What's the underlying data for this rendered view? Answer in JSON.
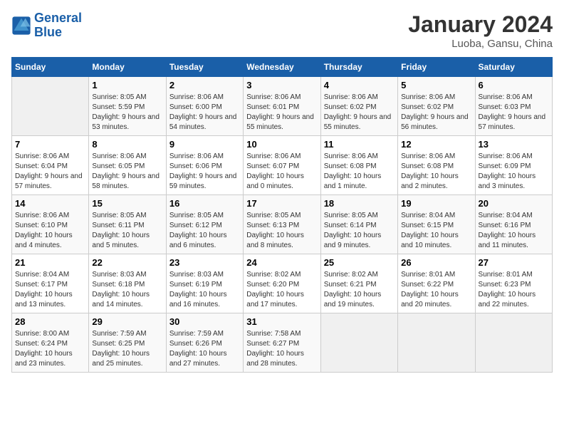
{
  "header": {
    "logo_general": "General",
    "logo_blue": "Blue",
    "title": "January 2024",
    "subtitle": "Luoba, Gansu, China"
  },
  "columns": [
    "Sunday",
    "Monday",
    "Tuesday",
    "Wednesday",
    "Thursday",
    "Friday",
    "Saturday"
  ],
  "weeks": [
    [
      {
        "day": "",
        "sunrise": "",
        "sunset": "",
        "daylight": ""
      },
      {
        "day": "1",
        "sunrise": "Sunrise: 8:05 AM",
        "sunset": "Sunset: 5:59 PM",
        "daylight": "Daylight: 9 hours and 53 minutes."
      },
      {
        "day": "2",
        "sunrise": "Sunrise: 8:06 AM",
        "sunset": "Sunset: 6:00 PM",
        "daylight": "Daylight: 9 hours and 54 minutes."
      },
      {
        "day": "3",
        "sunrise": "Sunrise: 8:06 AM",
        "sunset": "Sunset: 6:01 PM",
        "daylight": "Daylight: 9 hours and 55 minutes."
      },
      {
        "day": "4",
        "sunrise": "Sunrise: 8:06 AM",
        "sunset": "Sunset: 6:02 PM",
        "daylight": "Daylight: 9 hours and 55 minutes."
      },
      {
        "day": "5",
        "sunrise": "Sunrise: 8:06 AM",
        "sunset": "Sunset: 6:02 PM",
        "daylight": "Daylight: 9 hours and 56 minutes."
      },
      {
        "day": "6",
        "sunrise": "Sunrise: 8:06 AM",
        "sunset": "Sunset: 6:03 PM",
        "daylight": "Daylight: 9 hours and 57 minutes."
      }
    ],
    [
      {
        "day": "7",
        "sunrise": "Sunrise: 8:06 AM",
        "sunset": "Sunset: 6:04 PM",
        "daylight": "Daylight: 9 hours and 57 minutes."
      },
      {
        "day": "8",
        "sunrise": "Sunrise: 8:06 AM",
        "sunset": "Sunset: 6:05 PM",
        "daylight": "Daylight: 9 hours and 58 minutes."
      },
      {
        "day": "9",
        "sunrise": "Sunrise: 8:06 AM",
        "sunset": "Sunset: 6:06 PM",
        "daylight": "Daylight: 9 hours and 59 minutes."
      },
      {
        "day": "10",
        "sunrise": "Sunrise: 8:06 AM",
        "sunset": "Sunset: 6:07 PM",
        "daylight": "Daylight: 10 hours and 0 minutes."
      },
      {
        "day": "11",
        "sunrise": "Sunrise: 8:06 AM",
        "sunset": "Sunset: 6:08 PM",
        "daylight": "Daylight: 10 hours and 1 minute."
      },
      {
        "day": "12",
        "sunrise": "Sunrise: 8:06 AM",
        "sunset": "Sunset: 6:08 PM",
        "daylight": "Daylight: 10 hours and 2 minutes."
      },
      {
        "day": "13",
        "sunrise": "Sunrise: 8:06 AM",
        "sunset": "Sunset: 6:09 PM",
        "daylight": "Daylight: 10 hours and 3 minutes."
      }
    ],
    [
      {
        "day": "14",
        "sunrise": "Sunrise: 8:06 AM",
        "sunset": "Sunset: 6:10 PM",
        "daylight": "Daylight: 10 hours and 4 minutes."
      },
      {
        "day": "15",
        "sunrise": "Sunrise: 8:05 AM",
        "sunset": "Sunset: 6:11 PM",
        "daylight": "Daylight: 10 hours and 5 minutes."
      },
      {
        "day": "16",
        "sunrise": "Sunrise: 8:05 AM",
        "sunset": "Sunset: 6:12 PM",
        "daylight": "Daylight: 10 hours and 6 minutes."
      },
      {
        "day": "17",
        "sunrise": "Sunrise: 8:05 AM",
        "sunset": "Sunset: 6:13 PM",
        "daylight": "Daylight: 10 hours and 8 minutes."
      },
      {
        "day": "18",
        "sunrise": "Sunrise: 8:05 AM",
        "sunset": "Sunset: 6:14 PM",
        "daylight": "Daylight: 10 hours and 9 minutes."
      },
      {
        "day": "19",
        "sunrise": "Sunrise: 8:04 AM",
        "sunset": "Sunset: 6:15 PM",
        "daylight": "Daylight: 10 hours and 10 minutes."
      },
      {
        "day": "20",
        "sunrise": "Sunrise: 8:04 AM",
        "sunset": "Sunset: 6:16 PM",
        "daylight": "Daylight: 10 hours and 11 minutes."
      }
    ],
    [
      {
        "day": "21",
        "sunrise": "Sunrise: 8:04 AM",
        "sunset": "Sunset: 6:17 PM",
        "daylight": "Daylight: 10 hours and 13 minutes."
      },
      {
        "day": "22",
        "sunrise": "Sunrise: 8:03 AM",
        "sunset": "Sunset: 6:18 PM",
        "daylight": "Daylight: 10 hours and 14 minutes."
      },
      {
        "day": "23",
        "sunrise": "Sunrise: 8:03 AM",
        "sunset": "Sunset: 6:19 PM",
        "daylight": "Daylight: 10 hours and 16 minutes."
      },
      {
        "day": "24",
        "sunrise": "Sunrise: 8:02 AM",
        "sunset": "Sunset: 6:20 PM",
        "daylight": "Daylight: 10 hours and 17 minutes."
      },
      {
        "day": "25",
        "sunrise": "Sunrise: 8:02 AM",
        "sunset": "Sunset: 6:21 PM",
        "daylight": "Daylight: 10 hours and 19 minutes."
      },
      {
        "day": "26",
        "sunrise": "Sunrise: 8:01 AM",
        "sunset": "Sunset: 6:22 PM",
        "daylight": "Daylight: 10 hours and 20 minutes."
      },
      {
        "day": "27",
        "sunrise": "Sunrise: 8:01 AM",
        "sunset": "Sunset: 6:23 PM",
        "daylight": "Daylight: 10 hours and 22 minutes."
      }
    ],
    [
      {
        "day": "28",
        "sunrise": "Sunrise: 8:00 AM",
        "sunset": "Sunset: 6:24 PM",
        "daylight": "Daylight: 10 hours and 23 minutes."
      },
      {
        "day": "29",
        "sunrise": "Sunrise: 7:59 AM",
        "sunset": "Sunset: 6:25 PM",
        "daylight": "Daylight: 10 hours and 25 minutes."
      },
      {
        "day": "30",
        "sunrise": "Sunrise: 7:59 AM",
        "sunset": "Sunset: 6:26 PM",
        "daylight": "Daylight: 10 hours and 27 minutes."
      },
      {
        "day": "31",
        "sunrise": "Sunrise: 7:58 AM",
        "sunset": "Sunset: 6:27 PM",
        "daylight": "Daylight: 10 hours and 28 minutes."
      },
      {
        "day": "",
        "sunrise": "",
        "sunset": "",
        "daylight": ""
      },
      {
        "day": "",
        "sunrise": "",
        "sunset": "",
        "daylight": ""
      },
      {
        "day": "",
        "sunrise": "",
        "sunset": "",
        "daylight": ""
      }
    ]
  ]
}
